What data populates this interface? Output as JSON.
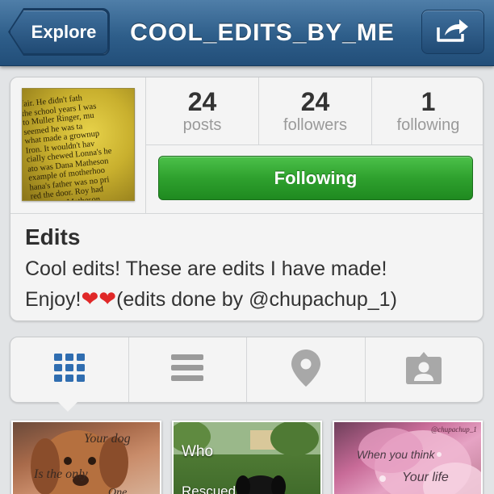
{
  "navbar": {
    "back_label": "Explore",
    "title": "COOL_EDITS_BY_ME",
    "share_icon": "share-arrow-icon"
  },
  "profile": {
    "avatar_text_lines": [
      "fair. He didn't fath",
      "the school years I was",
      "to Muller Ringer, mu",
      "seemed he was ta",
      "what made a grownup",
      "Iron. It wouldn't hav",
      "cially chewed Lonna's he",
      "ato was Dana Matheson",
      "example of motherhoo",
      "hana's father was no pri",
      "red the door. Roy had",
      "d, but Mr. Matheson"
    ],
    "stats": [
      {
        "count": "24",
        "label": "posts"
      },
      {
        "count": "24",
        "label": "followers"
      },
      {
        "count": "1",
        "label": "following"
      }
    ],
    "follow_button": "Following",
    "name": "Edits",
    "bio_line1": "Cool edits! These are edits I have made!",
    "bio_line2_start": "Enjoy!",
    "bio_hearts": [
      "❤",
      "❤"
    ],
    "bio_line2_end": "(edits done by @chupachup_1)"
  },
  "tabs": [
    {
      "name": "tab-grid",
      "icon": "grid-icon",
      "active": true
    },
    {
      "name": "tab-list",
      "icon": "list-icon",
      "active": false
    },
    {
      "name": "tab-map",
      "icon": "map-pin-icon",
      "active": false
    },
    {
      "name": "tab-tagged",
      "icon": "tagged-user-icon",
      "active": false
    }
  ],
  "grid": [
    {
      "top_text": "Your dog",
      "bottom_text": "Is the only",
      "extra": "One"
    },
    {
      "top_text": "Who",
      "bottom_text": "Rescued"
    },
    {
      "watermark": "@chupachup_1",
      "top_text": "When you think",
      "bottom_text": "Your life"
    }
  ],
  "colors": {
    "navbar": "#2e5e8a",
    "following_button": "#2fa12e",
    "active_tab_icon": "#2f6db0",
    "inactive_tab_icon": "#9a9a9a"
  }
}
